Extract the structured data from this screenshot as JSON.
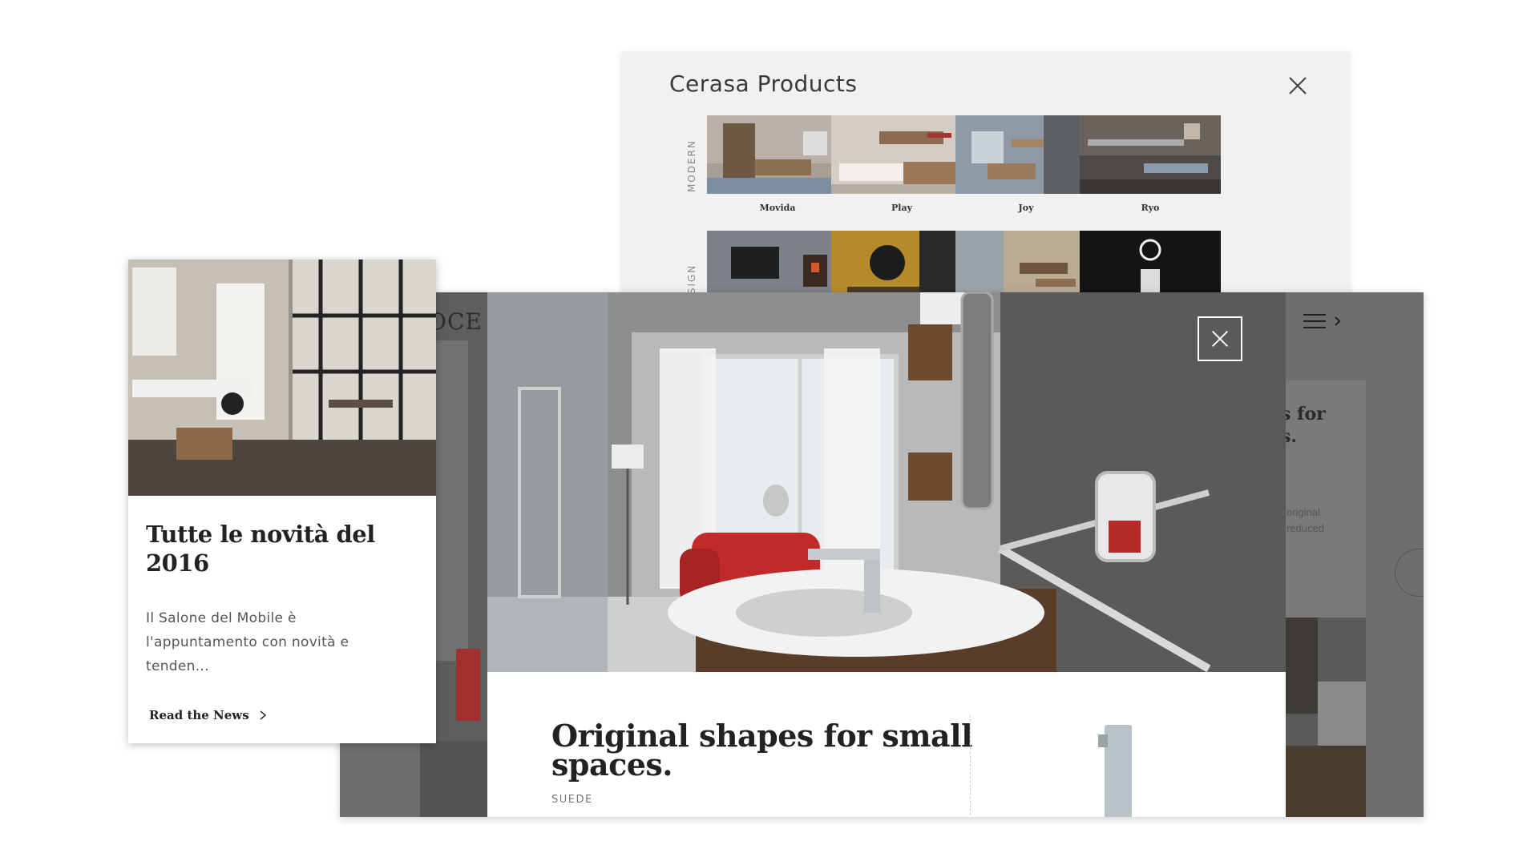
{
  "products_panel": {
    "title": "Cerasa Products",
    "rows": [
      {
        "label": "MODERN",
        "items": [
          {
            "name": "Movida"
          },
          {
            "name": "Play"
          },
          {
            "name": "Joy"
          },
          {
            "name": "Ryo"
          }
        ]
      },
      {
        "label": "DESIGN",
        "items": [
          {
            "name": ""
          },
          {
            "name": ""
          },
          {
            "name": ""
          },
          {
            "name": ""
          }
        ]
      }
    ]
  },
  "site": {
    "logo": "OCE",
    "card_title": "es for\nes.",
    "card_desc": "es: original\nnal reduced"
  },
  "lightbox": {
    "title": "Original shapes for small\nspaces.",
    "subtitle": "SUEDE"
  },
  "news_card": {
    "title": "Tutte le novità del\n2016",
    "body": "Il Salone del Mobile è\nl'appuntamento con novità e\ntenden...",
    "link": "Read the News"
  },
  "colors": {
    "overlay": "#6e6e6e",
    "panel_bg": "#f1f1f1",
    "accent_red": "#c22a2a"
  },
  "icons": {
    "close": "close-icon",
    "menu": "hamburger-icon",
    "chevron": "chevron-right-icon"
  }
}
